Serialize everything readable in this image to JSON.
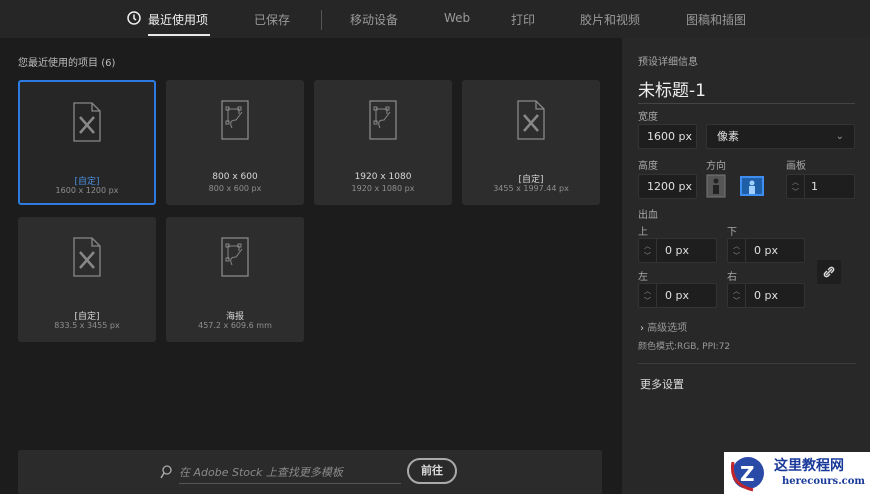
{
  "tabs": [
    {
      "label": "最近使用项",
      "icon": "clock-icon"
    },
    {
      "label": "已保存"
    },
    {
      "label": "移动设备"
    },
    {
      "label": "Web"
    },
    {
      "label": "打印"
    },
    {
      "label": "胶片和视频"
    },
    {
      "label": "图稿和插图"
    }
  ],
  "recent": {
    "title": "您最近使用的项目",
    "count": "(6)",
    "items": [
      {
        "name": "[自定]",
        "size": "1600 x 1200 px",
        "icon": "custom-document-icon"
      },
      {
        "name": "800 x 600",
        "size": "800 x 600 px",
        "icon": "artboard-document-icon"
      },
      {
        "name": "1920 x 1080",
        "size": "1920 x 1080 px",
        "icon": "artboard-document-icon"
      },
      {
        "name": "[自定]",
        "size": "3455 x 1997.44 px",
        "icon": "custom-document-icon"
      },
      {
        "name": "[自定]",
        "size": "833.5 x 3455 px",
        "icon": "custom-document-icon"
      },
      {
        "name": "海报",
        "size": "457.2 x 609.6 mm",
        "icon": "artboard-document-icon"
      }
    ]
  },
  "stock": {
    "placeholder": "在 Adobe Stock 上查找更多模板",
    "go": "前往"
  },
  "preset": {
    "header": "预设详细信息",
    "doc_title": "未标题-1",
    "width_label": "宽度",
    "width": "1600 px",
    "unit": "像素",
    "height_label": "高度",
    "height": "1200 px",
    "orientation_label": "方向",
    "artboards_label": "画板",
    "artboards": "1",
    "bleed_label": "出血",
    "top_label": "上",
    "bottom_label": "下",
    "left_label": "左",
    "right_label": "右",
    "top": "0 px",
    "bottom": "0 px",
    "left": "0 px",
    "right": "0 px",
    "advanced": "高级选项",
    "color_info": "颜色模式:RGB, PPI:72",
    "more": "更多设置"
  },
  "watermark": {
    "cn": "这里教程网",
    "en": "herecours.com"
  },
  "colors": {
    "accent": "#2d7be0"
  }
}
